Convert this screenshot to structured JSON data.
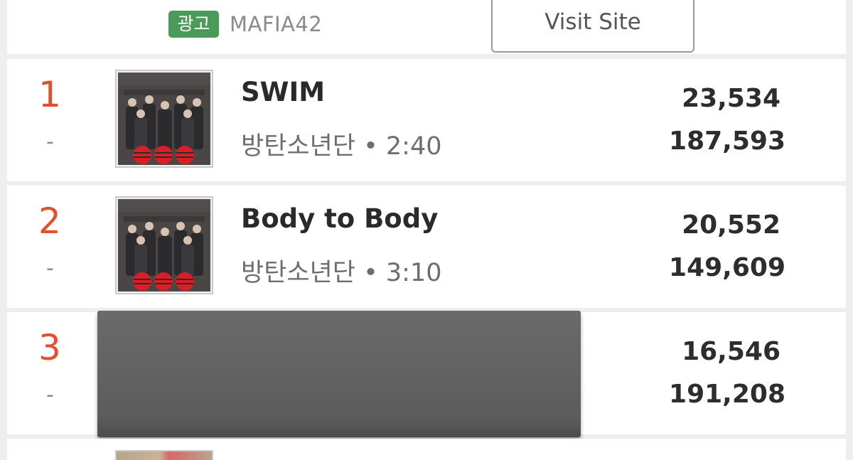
{
  "ad": {
    "badge": "광고",
    "name": "MAFIA42",
    "button_label": "Visit Site"
  },
  "rows": [
    {
      "rank": "1",
      "change": "-",
      "title": "SWIM",
      "artist_duration": "방탄소년단 • 2:40",
      "stat_a": "23,534",
      "stat_b": "187,593"
    },
    {
      "rank": "2",
      "change": "-",
      "title": "Body to Body",
      "artist_duration": "방탄소년단 • 3:10",
      "stat_a": "20,552",
      "stat_b": "149,609"
    },
    {
      "rank": "3",
      "change": "-",
      "stat_a": "16,546",
      "stat_b": "191,208"
    }
  ],
  "colors": {
    "rank": "#e2502e",
    "ad_badge": "#4a9a5a",
    "redaction": "#5e5e5e"
  }
}
